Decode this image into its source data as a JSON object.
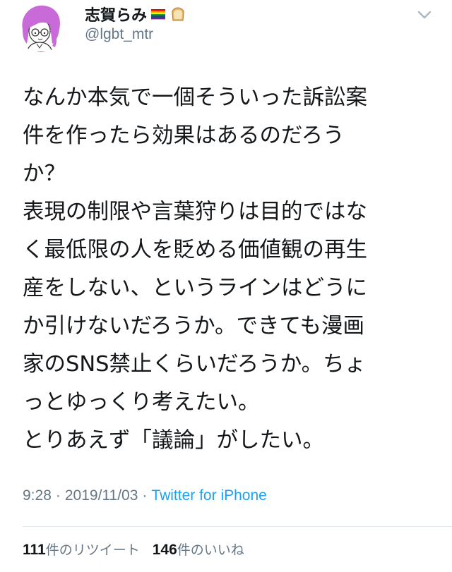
{
  "author": {
    "display_name": "志賀らみ",
    "handle": "@lgbt_mtr",
    "name_emoji": [
      "rainbow-flag-icon",
      "bread-icon"
    ],
    "avatar": "avatar-illustration"
  },
  "tweet": {
    "lines": [
      "なんか本気で一個そういった訴訟案",
      "件を作ったら効果はあるのだろう",
      "か？",
      "表現の制限や言葉狩りは目的ではな",
      "く最低限の人を貶める価値観の再生",
      "産をしない、というラインはどうに",
      "か引けないだろうか。できても漫画",
      "家のSNS禁止くらいだろうか。ちょ",
      "っとゆっくり考えたい。",
      "とりあえず「議論」がしたい。"
    ]
  },
  "meta": {
    "time": "9:28",
    "separator": "·",
    "date": "2019/11/03",
    "source": "Twitter for iPhone"
  },
  "stats": {
    "retweets_count": "111",
    "retweets_label": "件のリツイート",
    "likes_count": "146",
    "likes_label": "件のいいね"
  },
  "colors": {
    "text": "#14171a",
    "secondary": "#657786",
    "link": "#1da1f2",
    "avatar_hair": "#c86ad8"
  }
}
